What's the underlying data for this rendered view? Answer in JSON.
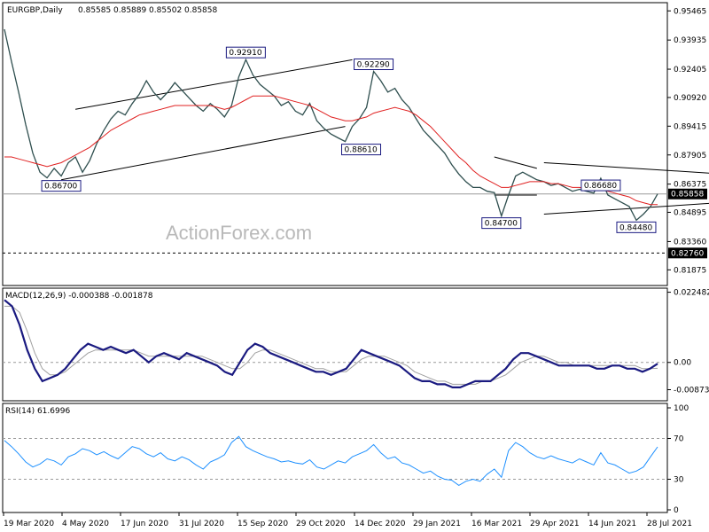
{
  "chart_data": [
    {
      "type": "line",
      "panel": "price",
      "title": "EURGBP,Daily",
      "ohlc": {
        "open": "0.85585",
        "high": "0.85889",
        "low": "0.85502",
        "close": "0.85858"
      },
      "ylim": [
        0.811,
        0.9585
      ],
      "y_ticks": [
        "0.95465",
        "0.93935",
        "0.92405",
        "0.90920",
        "0.89415",
        "0.87905",
        "0.86375",
        "0.84895",
        "0.83360",
        "0.81875"
      ],
      "last_price": "0.85858",
      "support_level": "0.82760",
      "x_tick_labels": [
        "19 Mar 2020",
        "4 May 2020",
        "17 Jun 2020",
        "31 Jul 2020",
        "15 Sep 2020",
        "29 Oct 2020",
        "14 Dec 2020",
        "29 Jan 2021",
        "16 Mar 2021",
        "29 Apr 2021",
        "14 Jun 2021",
        "28 Jul 2021"
      ],
      "series": [
        {
          "name": "",
          "values": [
            0.945,
            0.928,
            0.912,
            0.895,
            0.88,
            0.87,
            0.867,
            0.872,
            0.868,
            0.875,
            0.878,
            0.87,
            0.876,
            0.885,
            0.892,
            0.898,
            0.902,
            0.9,
            0.906,
            0.911,
            0.918,
            0.912,
            0.908,
            0.912,
            0.917,
            0.913,
            0.909,
            0.905,
            0.902,
            0.906,
            0.903,
            0.899,
            0.905,
            0.92,
            0.9291,
            0.921,
            0.916,
            0.913,
            0.91,
            0.905,
            0.907,
            0.902,
            0.9,
            0.9061,
            0.897,
            0.893,
            0.89,
            0.888,
            0.8861,
            0.894,
            0.898,
            0.904,
            0.9229,
            0.918,
            0.912,
            0.914,
            0.908,
            0.904,
            0.898,
            0.892,
            0.888,
            0.884,
            0.88,
            0.874,
            0.869,
            0.865,
            0.862,
            0.862,
            0.86,
            0.8593,
            0.847,
            0.858,
            0.868,
            0.87,
            0.868,
            0.866,
            0.865,
            0.863,
            0.864,
            0.862,
            0.86,
            0.861,
            0.86,
            0.859,
            0.8668,
            0.858,
            0.856,
            0.854,
            0.852,
            0.8448,
            0.848,
            0.852,
            0.8586
          ]
        },
        {
          "name": "",
          "values": [
            0.878,
            0.878,
            0.877,
            0.876,
            0.875,
            0.874,
            0.873,
            0.874,
            0.875,
            0.877,
            0.879,
            0.881,
            0.883,
            0.886,
            0.889,
            0.892,
            0.894,
            0.896,
            0.898,
            0.9,
            0.901,
            0.902,
            0.903,
            0.904,
            0.905,
            0.905,
            0.905,
            0.905,
            0.905,
            0.905,
            0.904,
            0.903,
            0.904,
            0.906,
            0.908,
            0.91,
            0.91,
            0.91,
            0.91,
            0.909,
            0.908,
            0.907,
            0.906,
            0.905,
            0.903,
            0.901,
            0.899,
            0.898,
            0.897,
            0.897,
            0.898,
            0.899,
            0.901,
            0.902,
            0.903,
            0.904,
            0.903,
            0.902,
            0.9,
            0.897,
            0.894,
            0.89,
            0.886,
            0.882,
            0.878,
            0.875,
            0.871,
            0.868,
            0.866,
            0.864,
            0.862,
            0.862,
            0.863,
            0.864,
            0.865,
            0.865,
            0.865,
            0.864,
            0.864,
            0.863,
            0.862,
            0.862,
            0.861,
            0.861,
            0.861,
            0.86,
            0.859,
            0.858,
            0.857,
            0.855,
            0.854,
            0.853,
            0.853
          ]
        }
      ],
      "annotations": [
        {
          "label": "0.92910",
          "x": 34,
          "y": 0.9291
        },
        {
          "label": "0.92290",
          "x": 52,
          "y": 0.9229
        },
        {
          "label": "0.88610",
          "x": 48,
          "y": 0.8861
        },
        {
          "label": "0.86700",
          "x": 6,
          "y": 0.867
        },
        {
          "label": "0.84700",
          "x": 70,
          "y": 0.847
        },
        {
          "label": "0.86680",
          "x": 84,
          "y": 0.8668
        },
        {
          "label": "0.84480",
          "x": 89,
          "y": 0.8448
        }
      ],
      "trendlines": [
        {
          "x": [
            10,
            49
          ],
          "y": [
            0.903,
            0.929
          ]
        },
        {
          "x": [
            8,
            48
          ],
          "y": [
            0.866,
            0.894
          ]
        },
        {
          "x": [
            76,
            110
          ],
          "y": [
            0.875,
            0.867
          ]
        },
        {
          "x": [
            76,
            110
          ],
          "y": [
            0.848,
            0.8562
          ]
        },
        {
          "x": [
            69,
            75
          ],
          "y": [
            0.878,
            0.872
          ]
        },
        {
          "x": [
            69,
            75
          ],
          "y": [
            0.858,
            0.858
          ]
        }
      ],
      "watermark": "ActionForex.com"
    },
    {
      "type": "line",
      "panel": "macd",
      "title": "MACD(12,26,9) -0.000388 -0.001878",
      "ylim": [
        -0.012,
        0.0235
      ],
      "y_ticks": [
        "0.022482",
        "0.00",
        "-0.008736"
      ],
      "series": [
        {
          "name": "",
          "values": [
            0.02,
            0.018,
            0.012,
            0.004,
            -0.002,
            -0.006,
            -0.005,
            -0.004,
            -0.002,
            0.001,
            0.004,
            0.006,
            0.005,
            0.004,
            0.005,
            0.004,
            0.003,
            0.004,
            0.002,
            0.0,
            0.002,
            0.003,
            0.002,
            0.001,
            0.003,
            0.002,
            0.001,
            0.0,
            -0.001,
            -0.003,
            -0.004,
            0.0,
            0.004,
            0.006,
            0.005,
            0.003,
            0.002,
            0.001,
            0.0,
            -0.001,
            -0.002,
            -0.003,
            -0.003,
            -0.004,
            -0.003,
            -0.002,
            0.001,
            0.004,
            0.003,
            0.002,
            0.001,
            0.0,
            -0.001,
            -0.003,
            -0.005,
            -0.006,
            -0.006,
            -0.007,
            -0.007,
            -0.008,
            -0.008,
            -0.007,
            -0.006,
            -0.006,
            -0.006,
            -0.004,
            -0.002,
            0.001,
            0.003,
            0.003,
            0.002,
            0.001,
            0.0,
            -0.001,
            -0.001,
            -0.001,
            -0.001,
            -0.001,
            -0.002,
            -0.002,
            -0.001,
            -0.001,
            -0.002,
            -0.002,
            -0.003,
            -0.002,
            -0.0004
          ]
        },
        {
          "name": "",
          "values": [
            0.018,
            0.018,
            0.016,
            0.01,
            0.003,
            -0.002,
            -0.004,
            -0.004,
            -0.003,
            -0.001,
            0.001,
            0.003,
            0.004,
            0.004,
            0.004,
            0.004,
            0.004,
            0.004,
            0.003,
            0.002,
            0.002,
            0.002,
            0.002,
            0.002,
            0.002,
            0.002,
            0.002,
            0.001,
            0.0,
            -0.001,
            -0.002,
            -0.002,
            0.0,
            0.003,
            0.004,
            0.004,
            0.003,
            0.002,
            0.001,
            0.0,
            -0.001,
            -0.002,
            -0.002,
            -0.003,
            -0.003,
            -0.003,
            -0.001,
            0.001,
            0.002,
            0.002,
            0.002,
            0.001,
            0.0,
            -0.001,
            -0.003,
            -0.004,
            -0.005,
            -0.006,
            -0.006,
            -0.007,
            -0.007,
            -0.007,
            -0.007,
            -0.006,
            -0.006,
            -0.005,
            -0.004,
            -0.002,
            0.0,
            0.001,
            0.002,
            0.002,
            0.001,
            0.0,
            0.0,
            -0.001,
            -0.001,
            -0.001,
            -0.001,
            -0.001,
            -0.001,
            -0.001,
            -0.001,
            -0.001,
            -0.002,
            -0.002,
            -0.0019
          ]
        }
      ]
    },
    {
      "type": "line",
      "panel": "rsi",
      "title": "RSI(14) 61.6996",
      "ylim": [
        0,
        100
      ],
      "y_ticks": [
        "100",
        "70",
        "30",
        "0"
      ],
      "levels": [
        70,
        30
      ],
      "series": [
        {
          "name": "",
          "values": [
            68,
            62,
            55,
            47,
            42,
            45,
            50,
            48,
            44,
            52,
            55,
            60,
            58,
            54,
            57,
            53,
            50,
            56,
            62,
            60,
            55,
            52,
            56,
            50,
            48,
            52,
            49,
            44,
            40,
            47,
            50,
            54,
            66,
            72,
            62,
            58,
            55,
            52,
            50,
            47,
            48,
            46,
            45,
            49,
            42,
            40,
            44,
            48,
            46,
            52,
            55,
            58,
            64,
            56,
            50,
            52,
            46,
            44,
            40,
            36,
            38,
            33,
            30,
            29,
            24,
            28,
            30,
            28,
            35,
            40,
            32,
            58,
            66,
            62,
            56,
            52,
            50,
            53,
            50,
            48,
            46,
            50,
            47,
            44,
            56,
            46,
            44,
            40,
            36,
            38,
            42,
            52,
            61.7
          ]
        }
      ]
    }
  ]
}
